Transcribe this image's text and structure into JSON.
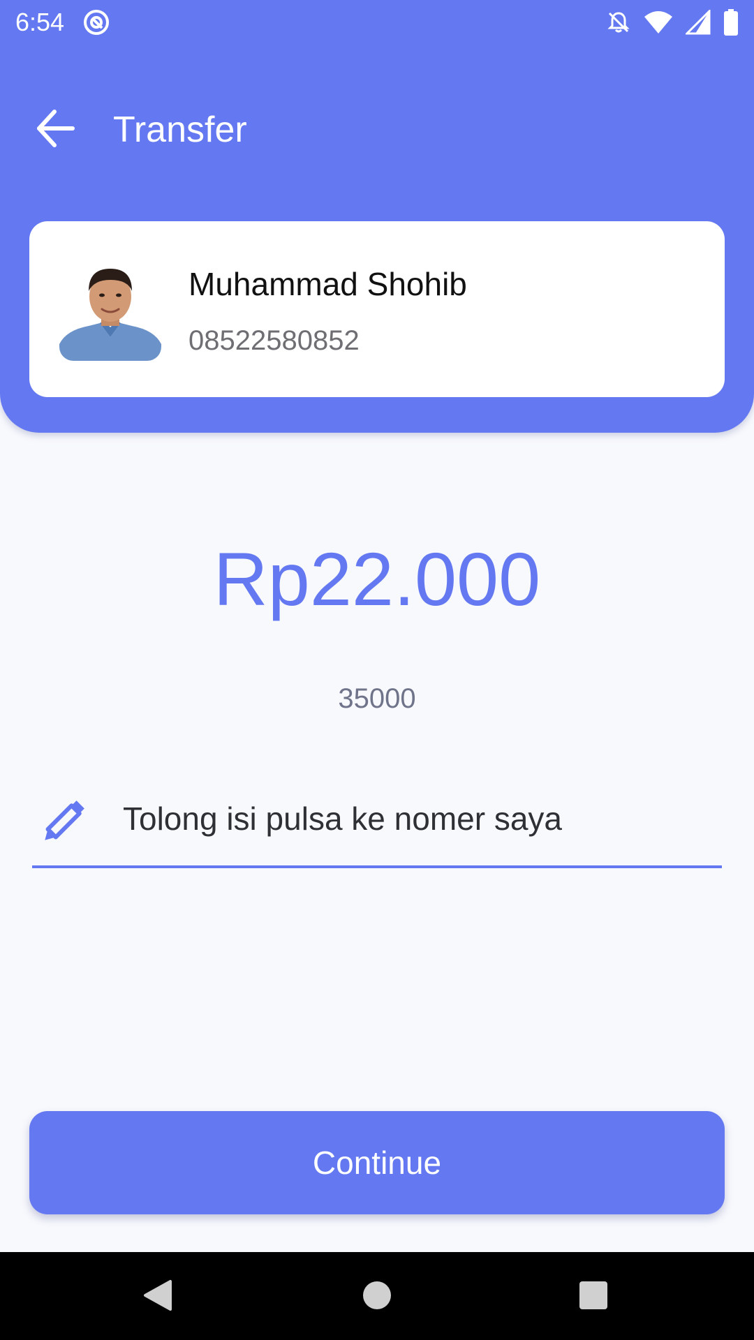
{
  "status_bar": {
    "time": "6:54",
    "icons": [
      "at-sign-icon",
      "notifications-off-icon",
      "wifi-icon",
      "cell-signal-icon",
      "battery-icon"
    ]
  },
  "toolbar": {
    "title": "Transfer",
    "back_icon": "arrow-left-icon"
  },
  "recipient": {
    "name": "Muhammad Shohib",
    "phone": "08522580852"
  },
  "amount": {
    "formatted": "Rp22.000",
    "secondary": "35000"
  },
  "note": {
    "icon": "pencil-icon",
    "value": "Tolong isi pulsa ke nomer saya"
  },
  "actions": {
    "continue_label": "Continue"
  },
  "nav_bar": {
    "icons": [
      "back-triangle-icon",
      "home-circle-icon",
      "recents-square-icon"
    ]
  },
  "colors": {
    "primary": "#6479f1",
    "background": "#f8f9fd",
    "card": "#ffffff",
    "nav_bar": "#000000"
  }
}
